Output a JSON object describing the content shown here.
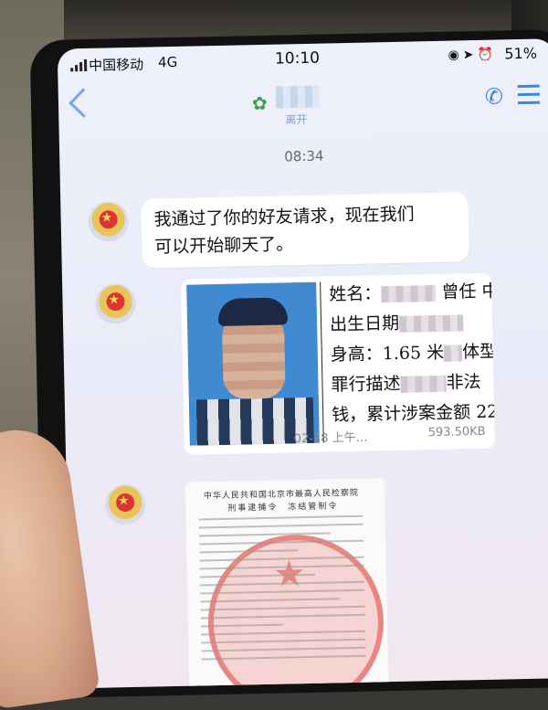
{
  "status_bar": {
    "carrier": "中国移动",
    "network": "4G",
    "time": "10:10",
    "battery": "51%"
  },
  "nav": {
    "title_subtitle": "离开"
  },
  "chat": {
    "timestamp": "08:34",
    "messages": [
      {
        "type": "text",
        "text_line1": "我通过了你的好友请求，现在我们",
        "text_line2": "可以开始聊天了。"
      },
      {
        "type": "image_card",
        "fields": {
          "name_label": "姓名：",
          "name_suffix": "曾任 中",
          "birth_label": "出生日期",
          "height_label": "身高：1.65 米",
          "height_suffix": "体型",
          "crime_label": "罪行描述",
          "crime_suffix": "非法",
          "amount_text": "钱，累计涉案金额 22"
        },
        "meta": "02-28 上午…",
        "file_size": "593.50KB"
      },
      {
        "type": "document",
        "doc_title": "中华人民共和国北京市最高人民检察院",
        "doc_subtitle": "刑事逮捕令　冻结管制令"
      }
    ]
  },
  "colors": {
    "accent": "#3b87e6",
    "bubble": "#ffffff",
    "screen_bg": "#eceefa"
  }
}
